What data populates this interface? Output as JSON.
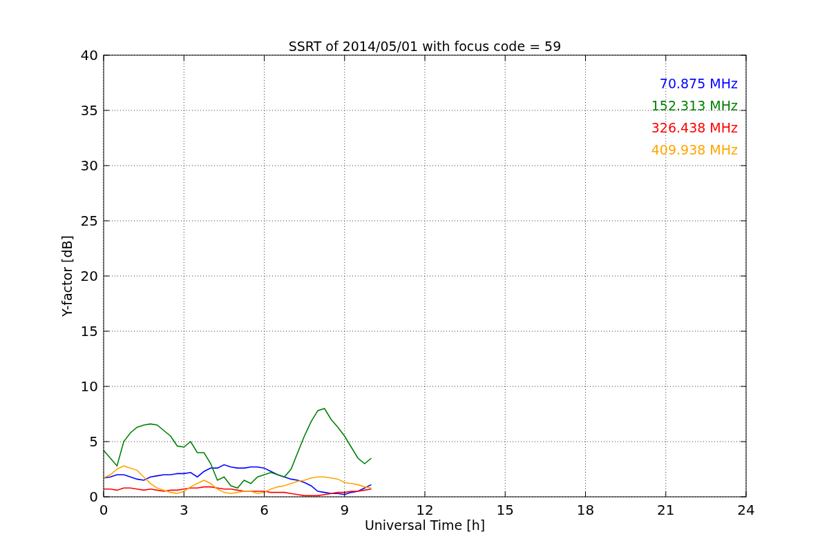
{
  "figure": {
    "chart_data": {
      "type": "line",
      "title": "SSRT of 2014/05/01 with focus code = 59",
      "xlabel": "Universal Time [h]",
      "ylabel": "Y-factor [dB]",
      "x": [
        0,
        0.25,
        0.5,
        0.75,
        1,
        1.25,
        1.5,
        1.75,
        2,
        2.25,
        2.5,
        2.75,
        3,
        3.25,
        3.5,
        3.75,
        4,
        4.25,
        4.5,
        4.75,
        5,
        5.25,
        5.5,
        5.75,
        6,
        6.25,
        6.5,
        6.75,
        7,
        7.25,
        7.5,
        7.75,
        8,
        8.25,
        8.5,
        8.75,
        9,
        9.25,
        9.5,
        9.75,
        10
      ],
      "series": [
        {
          "name": "70.875 MHz",
          "color": "#0000ff",
          "values": [
            1.7,
            1.8,
            2.0,
            2.0,
            1.8,
            1.6,
            1.5,
            1.8,
            1.9,
            2.0,
            2.0,
            2.1,
            2.1,
            2.2,
            1.8,
            2.3,
            2.6,
            2.6,
            2.9,
            2.7,
            2.6,
            2.6,
            2.7,
            2.7,
            2.6,
            2.3,
            2.0,
            1.8,
            1.6,
            1.5,
            1.3,
            1.0,
            0.5,
            0.4,
            0.3,
            0.3,
            0.2,
            0.4,
            0.5,
            0.8,
            1.1
          ]
        },
        {
          "name": "152.313 MHz",
          "color": "#008000",
          "values": [
            4.2,
            3.5,
            2.8,
            5.0,
            5.8,
            6.3,
            6.5,
            6.6,
            6.5,
            6.0,
            5.5,
            4.6,
            4.5,
            5.0,
            4.0,
            4.0,
            3.0,
            1.5,
            1.8,
            1.0,
            0.8,
            1.5,
            1.2,
            1.8,
            2.0,
            2.2,
            2.0,
            1.8,
            2.5,
            4.0,
            5.5,
            6.8,
            7.8,
            8.0,
            7.0,
            6.3,
            5.5,
            4.5,
            3.5,
            3.0,
            3.5
          ]
        },
        {
          "name": "326.438 MHz",
          "color": "#ff0000",
          "values": [
            0.7,
            0.7,
            0.6,
            0.8,
            0.8,
            0.7,
            0.6,
            0.7,
            0.6,
            0.5,
            0.6,
            0.6,
            0.7,
            0.8,
            0.8,
            0.9,
            0.9,
            0.8,
            0.7,
            0.7,
            0.6,
            0.5,
            0.5,
            0.5,
            0.5,
            0.4,
            0.4,
            0.4,
            0.3,
            0.2,
            0.1,
            0.1,
            0.1,
            0.2,
            0.3,
            0.4,
            0.4,
            0.5,
            0.5,
            0.6,
            0.7
          ]
        },
        {
          "name": "409.938 MHz",
          "color": "#ffa500",
          "values": [
            1.7,
            2.0,
            2.5,
            2.8,
            2.6,
            2.4,
            1.8,
            1.2,
            0.8,
            0.6,
            0.4,
            0.3,
            0.5,
            0.9,
            1.2,
            1.5,
            1.2,
            0.7,
            0.4,
            0.3,
            0.4,
            0.5,
            0.5,
            0.3,
            0.4,
            0.7,
            0.9,
            1.0,
            1.2,
            1.4,
            1.5,
            1.7,
            1.8,
            1.8,
            1.7,
            1.6,
            1.3,
            1.2,
            1.1,
            0.9,
            0.8
          ]
        }
      ],
      "grid": true,
      "xlim": [
        0,
        24
      ],
      "ylim": [
        0,
        40
      ],
      "xticks": [
        0,
        3,
        6,
        9,
        12,
        15,
        18,
        21,
        24
      ],
      "yticks": [
        0,
        5,
        10,
        15,
        20,
        25,
        30,
        35,
        40
      ]
    }
  }
}
